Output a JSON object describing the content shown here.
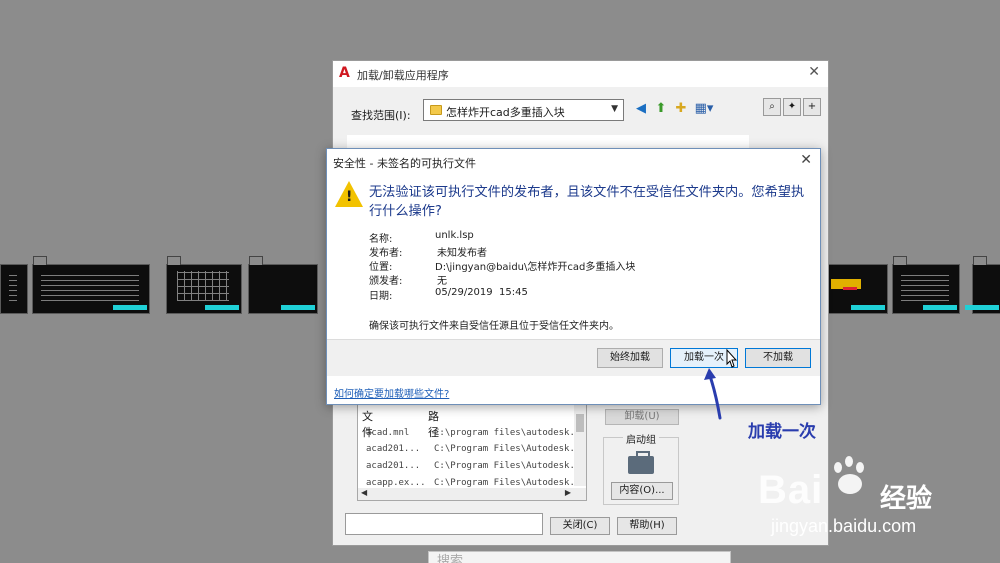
{
  "back_dialog": {
    "title": "加载/卸载应用程序",
    "look_in_label": "查找范围(I):",
    "look_in_value": "怎样炸开cad多重插入块",
    "list_headers": [
      "文件",
      "路径"
    ],
    "list_rows": [
      {
        "file": "acad.mnl",
        "path": "C:\\program files\\autodesk..."
      },
      {
        "file": "acad201...",
        "path": "C:\\Program Files\\Autodesk..."
      },
      {
        "file": "acad201...",
        "path": "C:\\Program Files\\Autodesk..."
      },
      {
        "file": "acapp.ex...",
        "path": "C:\\Program Files\\Autodesk..."
      }
    ],
    "unload_label": "卸载(U)",
    "startup_group_label": "启动组",
    "contents_label": "内容(O)...",
    "close_label": "关闭(C)",
    "help_label": "帮助(H)"
  },
  "security_dialog": {
    "title": "安全性 - 未签名的可执行文件",
    "heading": "无法验证该可执行文件的发布者，且该文件不在受信任文件夹内。您希望执行什么操作?",
    "fields": [
      {
        "label": "名称:",
        "value": "unlk.lsp"
      },
      {
        "label": "发布者:",
        "value": "未知发布者"
      },
      {
        "label": "位置:",
        "value": "D:\\jingyan@baidu\\怎样炸开cad多重插入块"
      },
      {
        "label": "颁发者:",
        "value": "无"
      },
      {
        "label": "日期:",
        "value": "05/29/2019  15:45"
      }
    ],
    "note": "确保该可执行文件来自受信任源且位于受信任文件夹内。",
    "btn_always": "始终加载",
    "btn_once": "加载一次",
    "btn_no": "不加载",
    "link": "如何确定要加载哪些文件?"
  },
  "annotation": "加载一次",
  "watermark": {
    "brand": "Bai",
    "brand_right": "经验",
    "url": "jingyan.baidu.com"
  },
  "search_bar": {
    "text": "搜索"
  },
  "colors": {
    "annotation": "#2a3dae",
    "heading": "#1c3a8c",
    "accent_border": "#0078d7",
    "warning": "#f2c200"
  }
}
